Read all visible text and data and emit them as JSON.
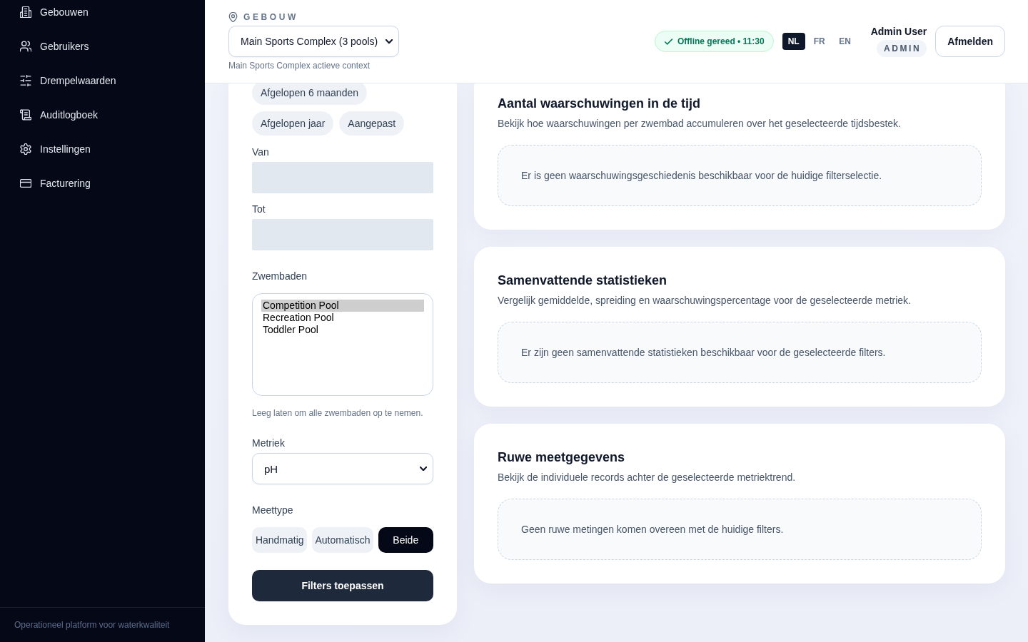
{
  "sidebar": {
    "items": [
      {
        "label": "Gebouwen"
      },
      {
        "label": "Gebruikers"
      },
      {
        "label": "Drempelwaarden"
      },
      {
        "label": "Auditlogboek"
      },
      {
        "label": "Instellingen"
      },
      {
        "label": "Facturering"
      }
    ],
    "footer": "Operationeel platform voor waterkwaliteit"
  },
  "header": {
    "building_label": "GEBOUW",
    "building_select": {
      "value": "Main Sports Complex (3 pools)"
    },
    "building_hint": "Main Sports Complex actieve context",
    "status": {
      "text": "Offline gereed • 11:30"
    },
    "languages": [
      {
        "label": "NL",
        "selected": true
      },
      {
        "label": "FR",
        "selected": false
      },
      {
        "label": "EN",
        "selected": false
      }
    ],
    "user": {
      "name": "Admin User",
      "role": "ADMIN"
    },
    "logout_button": "Afmelden"
  },
  "filters": {
    "period_chips": [
      {
        "label": "Afgelopen 6 maanden",
        "selected": false
      },
      {
        "label": "Afgelopen jaar",
        "selected": false
      },
      {
        "label": "Aangepast",
        "selected": false
      }
    ],
    "from": {
      "label": "Van",
      "disabled": true
    },
    "to": {
      "label": "Tot",
      "disabled": true
    },
    "pools": {
      "label": "Zwembaden",
      "options": [
        {
          "label": "Competition Pool",
          "selected": true
        },
        {
          "label": "Recreation Pool",
          "selected": false
        },
        {
          "label": "Toddler Pool",
          "selected": false
        }
      ],
      "hint": "Leeg laten om alle zwembaden op te nemen."
    },
    "metric": {
      "label": "Metriek",
      "value": "pH"
    },
    "measure_type": {
      "label": "Meettype",
      "options": [
        {
          "label": "Handmatig",
          "selected": false
        },
        {
          "label": "Automatisch",
          "selected": false
        },
        {
          "label": "Beide",
          "selected": true
        }
      ]
    },
    "apply_button": "Filters toepassen"
  },
  "cards": [
    {
      "title": "Aantal waarschuwingen in de tijd",
      "description": "Bekijk hoe waarschuwingen per zwembad accumuleren over het geselecteerde tijdsbestek.",
      "empty_message": "Er is geen waarschuwingsgeschiedenis beschikbaar voor de huidige filterselectie."
    },
    {
      "title": "Samenvattende statistieken",
      "description": "Vergelijk gemiddelde, spreiding en waarschuwingspercentage voor de geselecteerde metriek.",
      "empty_message": "Er zijn geen samenvattende statistieken beschikbaar voor de geselecteerde filters."
    },
    {
      "title": "Ruwe meetgegevens",
      "description": "Bekijk de individuele records achter de geselecteerde metriektrend.",
      "empty_message": "Geen ruwe metingen komen overeen met de huidige filters."
    }
  ]
}
